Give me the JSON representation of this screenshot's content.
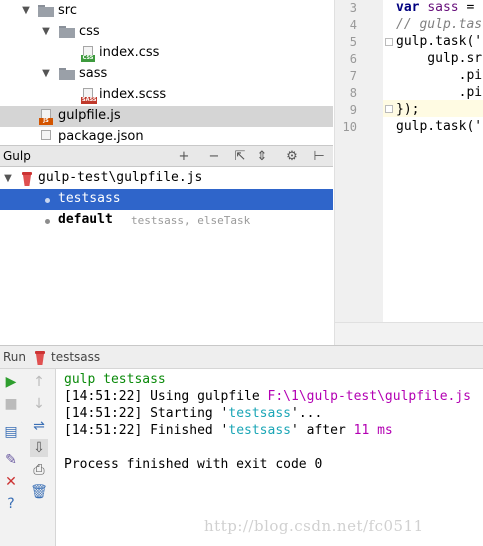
{
  "project_tree": {
    "items": [
      {
        "label": "src",
        "kind": "folder"
      },
      {
        "label": "css",
        "kind": "folder"
      },
      {
        "label": "index.css",
        "kind": "file",
        "badge": "CSS",
        "badge_color": "#3d9a3d"
      },
      {
        "label": "sass",
        "kind": "folder"
      },
      {
        "label": "index.scss",
        "kind": "file",
        "badge": "SASS",
        "badge_color": "#c0392b"
      },
      {
        "label": "gulpfile.js",
        "kind": "file",
        "badge": "JS",
        "badge_color": "#d35400"
      },
      {
        "label": "package.json",
        "kind": "file",
        "badge": "",
        "badge_color": "#888888"
      }
    ]
  },
  "editor": {
    "line_numbers": [
      "3",
      "4",
      "5",
      "6",
      "7",
      "8",
      "9",
      "10"
    ],
    "lines": [
      {
        "kw": "var",
        "rest_var": "sass",
        "rest": " ="
      },
      {
        "comment": "// gulp.tas"
      },
      {
        "text": "gulp.task('"
      },
      {
        "text": "    gulp.sr"
      },
      {
        "text": "        .pi"
      },
      {
        "text": "        .pi"
      },
      {
        "text": "});"
      },
      {
        "text": "gulp.task('"
      }
    ]
  },
  "gulp_panel": {
    "title": "Gulp",
    "buttons": {
      "add": "+",
      "remove": "−",
      "collapse": "⇱",
      "expand": "⇕",
      "settings": "⚙",
      "pin": "⊢"
    },
    "root": "gulp-test\\gulpfile.js",
    "tasks": [
      {
        "name": "testsass",
        "deps": ""
      },
      {
        "name": "default",
        "deps": "testsass, elseTask"
      }
    ]
  },
  "run_panel": {
    "label": "Run",
    "task": "testsass",
    "console": {
      "cmd": "gulp testsass",
      "l1_time": "[14:51:22]",
      "l1_text": " Using gulpfile ",
      "l1_path": "F:\\1\\gulp-test\\gulpfile.js",
      "l2_time": "[14:51:22]",
      "l2_text": " Starting '",
      "l2_task": "testsass",
      "l2_end": "'...",
      "l3_time": "[14:51:22]",
      "l3_text": " Finished '",
      "l3_task": "testsass",
      "l3_mid": "' after ",
      "l3_dur": "11 ms",
      "exit": "Process finished with exit code 0"
    }
  },
  "watermark": "http://blog.csdn.net/fc0511"
}
